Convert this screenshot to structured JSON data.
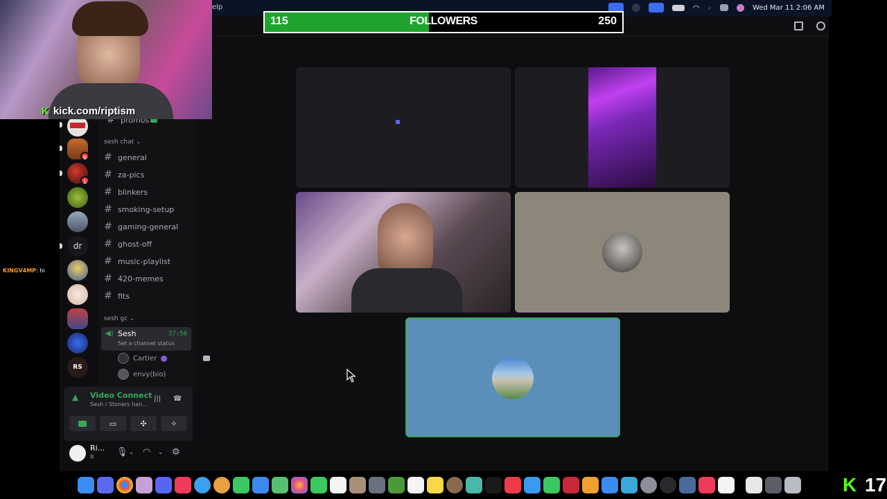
{
  "menubar": {
    "app_menu_fragment": "elp",
    "datetime": "Wed Mar 11  2:06 AM"
  },
  "followers_goal": {
    "current": "115",
    "label": "FOLLOWERS",
    "goal": "250",
    "progress": 0.46
  },
  "webcam": {
    "handle": "kick.com/riptism",
    "logo_letter": "K"
  },
  "chat_overlay": {
    "user": "KINGV4MP",
    "message": ": hi"
  },
  "server_rail": {
    "badges": [
      "6",
      "1"
    ],
    "dm_letters": "dr"
  },
  "channels": {
    "partial_top": "promos",
    "category_sesh_chat": "sesh chat",
    "text_channels": [
      "general",
      "za-pics",
      "blinkers",
      "smoking-setup",
      "gaming-general",
      "ghost-off",
      "music-playlist",
      "420-memes",
      "fits"
    ],
    "category_sesh_gc": "sesh gc",
    "voice_channel": {
      "name": "Sesh",
      "timer": "37:56",
      "status": "Set a channel status"
    },
    "voice_users": [
      "Cartier",
      "envy(bio)"
    ]
  },
  "voice_panel": {
    "title": "Video Connecte",
    "subtitle": "Sesh / Stoners han..."
  },
  "user_bar": {
    "name": "Ri...",
    "status": "R"
  },
  "kick_counter": {
    "logo": "K",
    "viewers": "17"
  },
  "colors": {
    "accent_green": "#3ba55c",
    "kick_green": "#53fc18",
    "follower_fill": "#1fa52e",
    "speaking_outline": "#3ba55c"
  }
}
